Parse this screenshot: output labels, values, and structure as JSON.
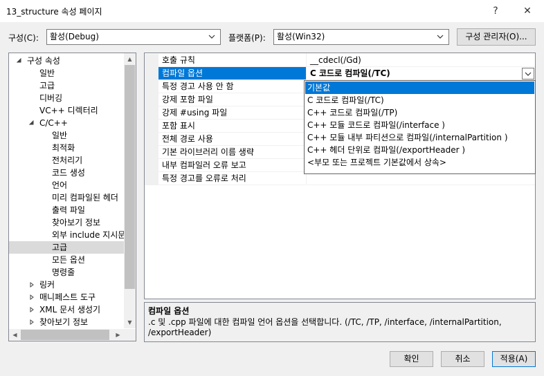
{
  "window": {
    "title": "13_structure 속성 페이지",
    "help_label": "?",
    "close_label": "✕"
  },
  "config": {
    "label": "구성(C):",
    "value": "활성(Debug)",
    "platform_label": "플랫폼(P):",
    "platform_value": "활성(Win32)",
    "manager_label": "구성 관리자(O)..."
  },
  "tree": {
    "items": [
      {
        "label": "구성 속성",
        "level": 0,
        "expanded": true
      },
      {
        "label": "일반",
        "level": 1
      },
      {
        "label": "고급",
        "level": 1
      },
      {
        "label": "디버깅",
        "level": 1
      },
      {
        "label": "VC++ 디렉터리",
        "level": 1
      },
      {
        "label": "C/C++",
        "level": 1,
        "expanded": true
      },
      {
        "label": "일반",
        "level": 2
      },
      {
        "label": "최적화",
        "level": 2
      },
      {
        "label": "전처리기",
        "level": 2
      },
      {
        "label": "코드 생성",
        "level": 2
      },
      {
        "label": "언어",
        "level": 2
      },
      {
        "label": "미리 컴파일된 헤더",
        "level": 2
      },
      {
        "label": "출력 파일",
        "level": 2
      },
      {
        "label": "찾아보기 정보",
        "level": 2
      },
      {
        "label": "외부 include 지시문",
        "level": 2
      },
      {
        "label": "고급",
        "level": 2,
        "selected": true
      },
      {
        "label": "모든 옵션",
        "level": 2
      },
      {
        "label": "명령줄",
        "level": 2
      },
      {
        "label": "링커",
        "level": 1,
        "expanded": false
      },
      {
        "label": "매니페스트 도구",
        "level": 1,
        "expanded": false
      },
      {
        "label": "XML 문서 생성기",
        "level": 1,
        "expanded": false
      },
      {
        "label": "찾아보기 정보",
        "level": 1,
        "expanded": false
      }
    ]
  },
  "grid": {
    "rows": [
      {
        "name": "호출 규칙",
        "value": "__cdecl(/Gd)"
      },
      {
        "name": "컴파일 옵션",
        "value": "C 코드로 컴파일(/TC)",
        "selected": true
      },
      {
        "name": "특정 경고 사용 안 함",
        "value": ""
      },
      {
        "name": "강제 포함 파일",
        "value": ""
      },
      {
        "name": "강제 #using 파일",
        "value": ""
      },
      {
        "name": "포함 표시",
        "value": ""
      },
      {
        "name": "전체 경로 사용",
        "value": ""
      },
      {
        "name": "기본 라이브러리 이름 생략",
        "value": ""
      },
      {
        "name": "내부 컴파일러 오류 보고",
        "value": ""
      },
      {
        "name": "특정 경고를 오류로 처리",
        "value": ""
      }
    ]
  },
  "dropdown": {
    "options": [
      {
        "label": "기본값",
        "selected": true
      },
      {
        "label": "C 코드로 컴파일(/TC)"
      },
      {
        "label": "C++ 코드로 컴파일(/TP)"
      },
      {
        "label": "C++ 모듈 코드로 컴파일(/interface )"
      },
      {
        "label": "C++ 모듈 내부 파티션으로 컴파일(/internalPartition )"
      },
      {
        "label": "C++ 헤더 단위로 컴파일(/exportHeader )"
      },
      {
        "label": "<부모 또는 프로젝트 기본값에서 상속>"
      }
    ]
  },
  "description": {
    "title": "컴파일 옵션",
    "text": ".c 및 .cpp 파일에 대한 컴파일 언어 옵션을 선택합니다.     (/TC, /TP, /interface, /internalPartition, /exportHeader)"
  },
  "buttons": {
    "ok": "확인",
    "cancel": "취소",
    "apply": "적용(A)"
  },
  "colors": {
    "accent": "#0078d7",
    "selected_tree": "#dadada"
  }
}
